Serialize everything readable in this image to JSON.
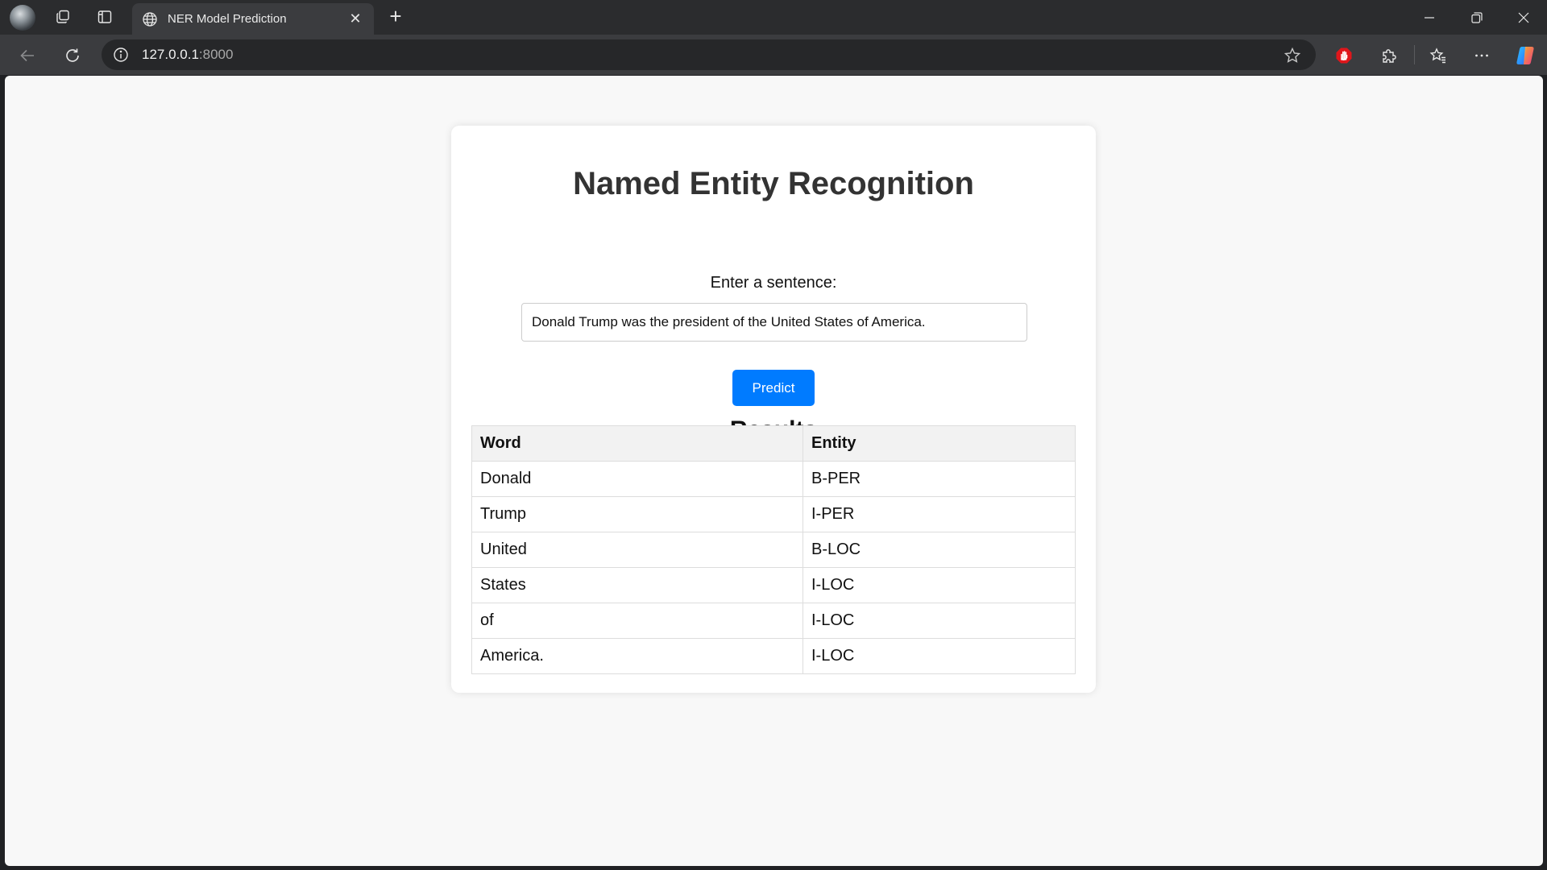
{
  "browser": {
    "tab_title": "NER Model Prediction",
    "tab_close": "✕",
    "new_tab": "+",
    "url_host": "127.0.0.1",
    "url_port": ":8000"
  },
  "page": {
    "title": "Named Entity Recognition",
    "input_label": "Enter a sentence:",
    "input_value": "Donald Trump was the president of the United States of America.",
    "predict_label": "Predict",
    "results_heading": "Results"
  },
  "table": {
    "headers": [
      "Word",
      "Entity"
    ],
    "rows": [
      [
        "Donald",
        "B-PER"
      ],
      [
        "Trump",
        "I-PER"
      ],
      [
        "United",
        "B-LOC"
      ],
      [
        "States",
        "I-LOC"
      ],
      [
        "of",
        "I-LOC"
      ],
      [
        "America.",
        "I-LOC"
      ]
    ]
  },
  "colors": {
    "accent": "#007bff",
    "chrome_dark": "#2b2c2e",
    "chrome_toolbar": "#3b3c3f"
  }
}
